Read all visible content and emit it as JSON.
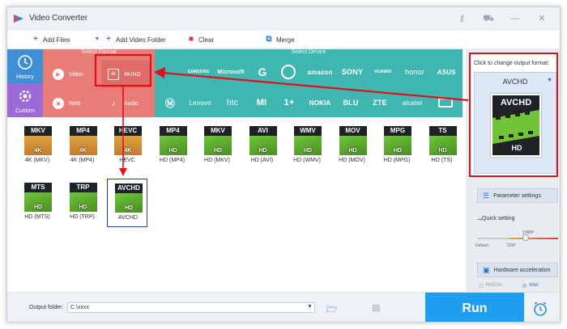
{
  "titlebar": {
    "title": "Video Converter"
  },
  "toolbar": {
    "add_files": "Add Files",
    "add_video_folder": "Add Video Folder",
    "clear": "Clear",
    "merge": "Merge"
  },
  "side_tabs": {
    "history": "History",
    "custom": "Custom"
  },
  "select_format": {
    "header": "Select Format",
    "categories": [
      "Video",
      "4K/HD",
      "Web",
      "Audio"
    ]
  },
  "select_device": {
    "header": "Select Device",
    "brands_row1": [
      "SAMSUNG",
      "Microsoft",
      "Google",
      "LG",
      "amazon",
      "SONY",
      "HUAWEI",
      "honor",
      "ASUS"
    ],
    "brands_row2": [
      "Motorola",
      "Lenovo",
      "htc",
      "MI",
      "OnePlus",
      "NOKIA",
      "BLU",
      "ZTE",
      "alcatel",
      "TV"
    ]
  },
  "formats": [
    {
      "name": "MKV",
      "sub": "4K",
      "caption": "4K (MKV)"
    },
    {
      "name": "MP4",
      "sub": "4K",
      "caption": "4K (MP4)"
    },
    {
      "name": "HEVC",
      "sub": "4K",
      "caption": "HEVC"
    },
    {
      "name": "MP4",
      "sub": "HD",
      "caption": "HD (MP4)"
    },
    {
      "name": "MKV",
      "sub": "HD",
      "caption": "HD (MKV)"
    },
    {
      "name": "AVI",
      "sub": "HD",
      "caption": "HD (AVI)"
    },
    {
      "name": "WMV",
      "sub": "HD",
      "caption": "HD (WMV)"
    },
    {
      "name": "MOV",
      "sub": "HD",
      "caption": "HD (MOV)"
    },
    {
      "name": "MPG",
      "sub": "HD",
      "caption": "HD (MPG)"
    },
    {
      "name": "TS",
      "sub": "HD",
      "caption": "HD (TS)"
    },
    {
      "name": "MTS",
      "sub": "HD",
      "caption": "HD (MTS)"
    },
    {
      "name": "TRP",
      "sub": "HD",
      "caption": "HD (TRP)"
    },
    {
      "name": "AVCHD",
      "sub": "HD",
      "caption": "AVCHD"
    }
  ],
  "output": {
    "hint": "Click to change output format:",
    "format": "AVCHD",
    "icon_name": "AVCHD",
    "icon_sub": "HD"
  },
  "settings": {
    "parameter": "Parameter settings",
    "quick": "Quick setting",
    "ticks": [
      "Default",
      "720P",
      "1080P"
    ],
    "hw_accel": "Hardware acceleration",
    "nvidia": "NVIDIA",
    "intel": "Intel"
  },
  "bottom": {
    "output_folder_label": "Output folder:",
    "output_folder_value": "C:\\xxxx",
    "run": "Run"
  },
  "colors": {
    "format_bg": "#e87c77",
    "device_bg": "#3fb6b0",
    "accent": "#1e9ef0",
    "annotation": "#e0101a"
  }
}
